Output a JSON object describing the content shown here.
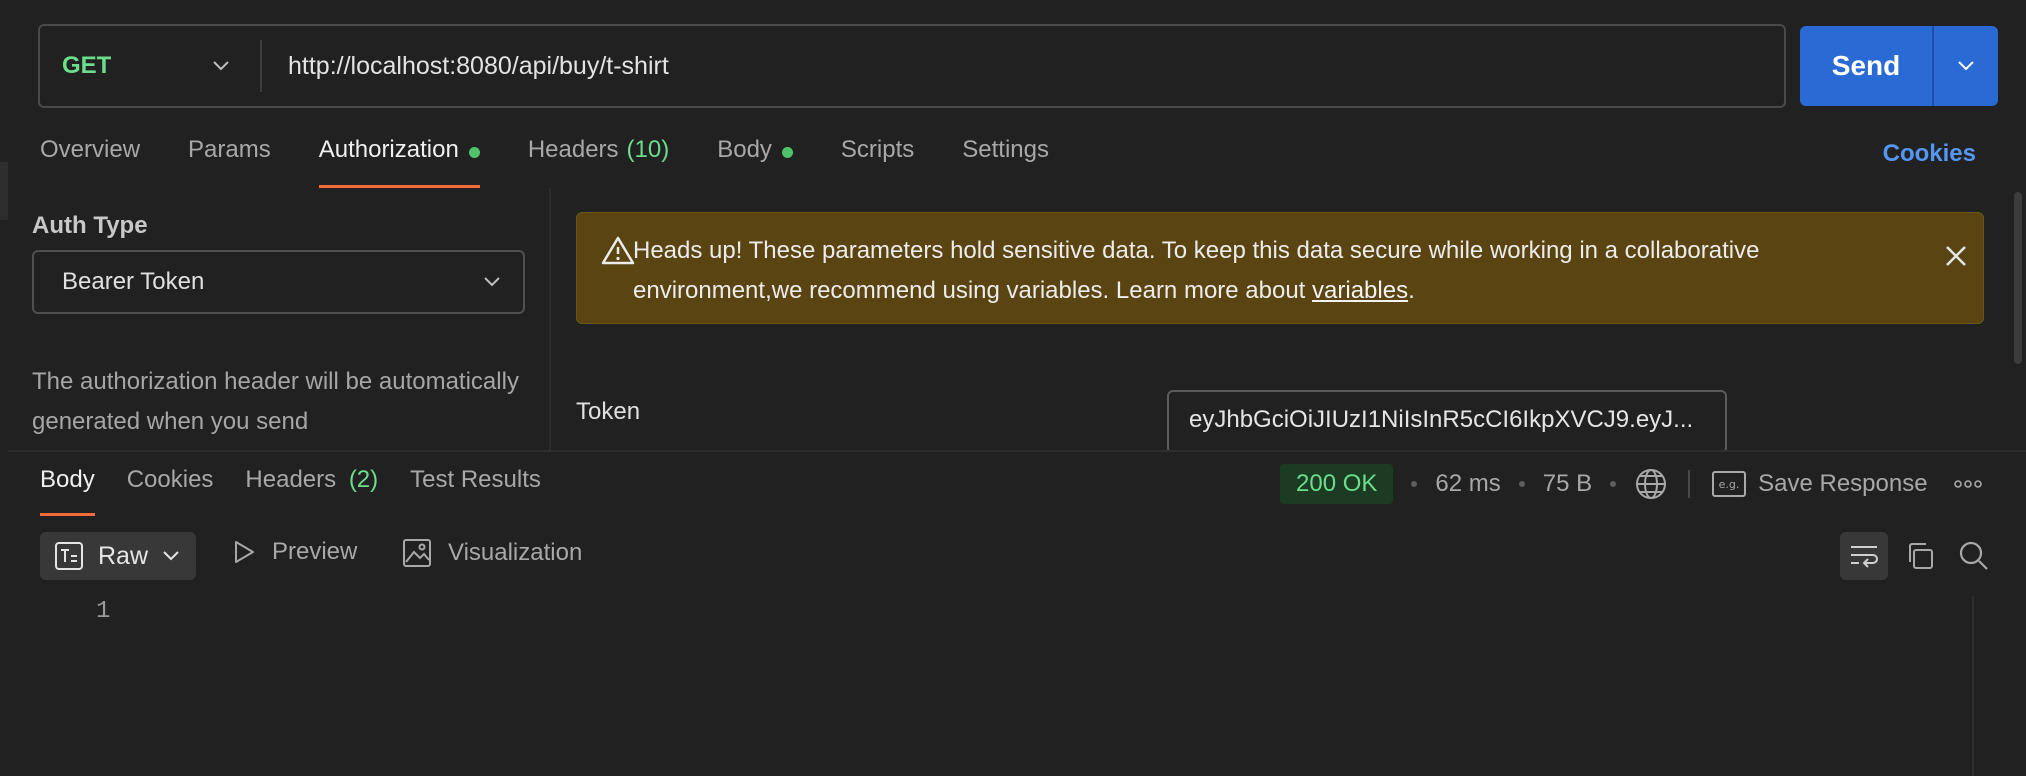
{
  "request": {
    "method": "GET",
    "url": "http://localhost:8080/api/buy/t-shirt",
    "send_label": "Send"
  },
  "request_tabs": [
    {
      "label": "Overview"
    },
    {
      "label": "Params"
    },
    {
      "label": "Authorization"
    },
    {
      "label": "Headers",
      "count": "(10)"
    },
    {
      "label": "Body"
    },
    {
      "label": "Scripts"
    },
    {
      "label": "Settings"
    }
  ],
  "cookies_link": "Cookies",
  "auth": {
    "type_label": "Auth Type",
    "type_value": "Bearer Token",
    "description": "The authorization header will be automatically generated when you send"
  },
  "warning": {
    "text_before": "Heads up! These parameters hold sensitive data. To keep this data secure while working in a collaborative environment,we recommend using variables. Learn more about ",
    "link": "variables",
    "text_after": "."
  },
  "token": {
    "label": "Token",
    "value": "eyJhbGciOiJIUzI1NiIsInR5cCI6IkpXVCJ9.eyJ..."
  },
  "response_tabs": [
    {
      "label": "Body"
    },
    {
      "label": "Cookies"
    },
    {
      "label": "Headers",
      "count": "(2)"
    },
    {
      "label": "Test Results"
    }
  ],
  "response_meta": {
    "status": "200 OK",
    "time": "62 ms",
    "size": "75 B",
    "save_label": "Save Response"
  },
  "response_view": {
    "format": "Raw",
    "preview_label": "Preview",
    "visualization_label": "Visualization"
  },
  "editor": {
    "line_numbers": [
      "1"
    ]
  },
  "colors": {
    "accent_orange": "#f26b3a",
    "send_blue": "#2a6ad4",
    "method_green": "#6bdd8b",
    "warning_bg": "#5a4411"
  }
}
